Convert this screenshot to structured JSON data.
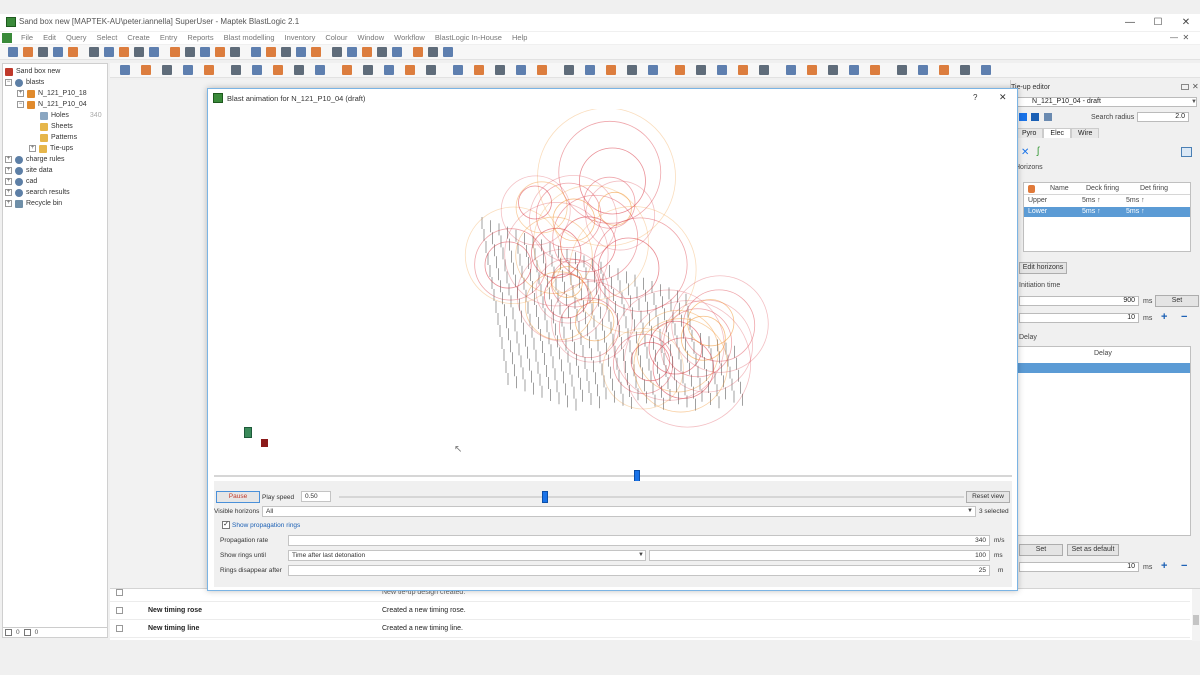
{
  "window": {
    "title": "Sand box new [MAPTEK-AU\\peter.iannella] SuperUser - Maptek BlastLogic 2.1",
    "minimize": "—",
    "maximize": "☐",
    "close": "✕"
  },
  "menu": {
    "items": [
      "File",
      "Edit",
      "Query",
      "Select",
      "Create",
      "Entry",
      "Reports",
      "Blast modelling",
      "Inventory",
      "Colour",
      "Window",
      "Workflow",
      "BlastLogic In-House",
      "Help"
    ]
  },
  "tree": {
    "root": "Sand box new",
    "blasts": "blasts",
    "n121_p10_18": "N_121_P10_18",
    "n121_p10_04": "N_121_P10_04",
    "holes": "Holes",
    "holes_count": "340",
    "sheets": "Sheets",
    "patterns": "Patterns",
    "tieups": "Tie-ups",
    "charge_rules": "charge rules",
    "site_data": "site data",
    "cad": "cad",
    "search_results": "search results",
    "recycle_bin": "Recycle bin",
    "footer_a": "0",
    "footer_b": "0"
  },
  "dialog": {
    "title": "Blast animation for N_121_P10_04 (draft)",
    "help": "?",
    "close": "✕",
    "pause_label": "Pause",
    "play_speed_label": "Play speed",
    "play_speed_value": "0.50",
    "reset_view_label": "Reset view",
    "visible_horizons_label": "Visible horizons",
    "visible_horizons_value": "All",
    "selected_count": "3 selected",
    "show_rings_label": "Show propagation rings",
    "propagation_rate_label": "Propagation rate",
    "propagation_rate_value": "340",
    "propagation_rate_unit": "m/s",
    "show_rings_until_label": "Show rings until",
    "show_rings_until_value": "Time after last detonation",
    "show_rings_until_ms": "100",
    "ms_unit": "ms",
    "rings_disappear_label": "Rings disappear after",
    "rings_disappear_value": "25",
    "m_unit": "m",
    "progress": 0.53,
    "speed": 0.33
  },
  "right_panel": {
    "header": "Tie-up editor",
    "tieup_select": "N_121_P10_04 - draft",
    "search_radius_label": "Search radius",
    "search_radius_value": "2.0",
    "tabs": [
      "Pyro",
      "Elec",
      "Wire"
    ],
    "horizons_label": "Horizons",
    "table_headers": [
      "Name",
      "Deck firing",
      "Det firing"
    ],
    "table_rows": [
      {
        "name": "Upper",
        "deck": "5ms ↑",
        "det": "5ms ↑"
      },
      {
        "name": "Lower",
        "deck": "5ms ↑",
        "det": "5ms ↑"
      }
    ],
    "edit_horizons": "Edit horizons",
    "initiation_time_label": "Initiation time",
    "initiation_value": "900",
    "initiation_step": "10",
    "ms": "ms",
    "set_label": "Set",
    "delays_label": "Delay",
    "delay_header": "Delay",
    "set_btn2": "Set",
    "set_as_default": "Set as default",
    "bottom_value": "10"
  },
  "log": {
    "rows": [
      {
        "name": "",
        "message": "New tie-up design created."
      },
      {
        "name": "New timing rose",
        "message": "Created a new timing rose."
      },
      {
        "name": "New timing line",
        "message": "Created a new timing line."
      }
    ]
  },
  "colors": {
    "accent": "#1a73e8",
    "ring_red": "#d9333f",
    "ring_orange": "#f0922b",
    "selected_row": "#5b9bd5"
  }
}
